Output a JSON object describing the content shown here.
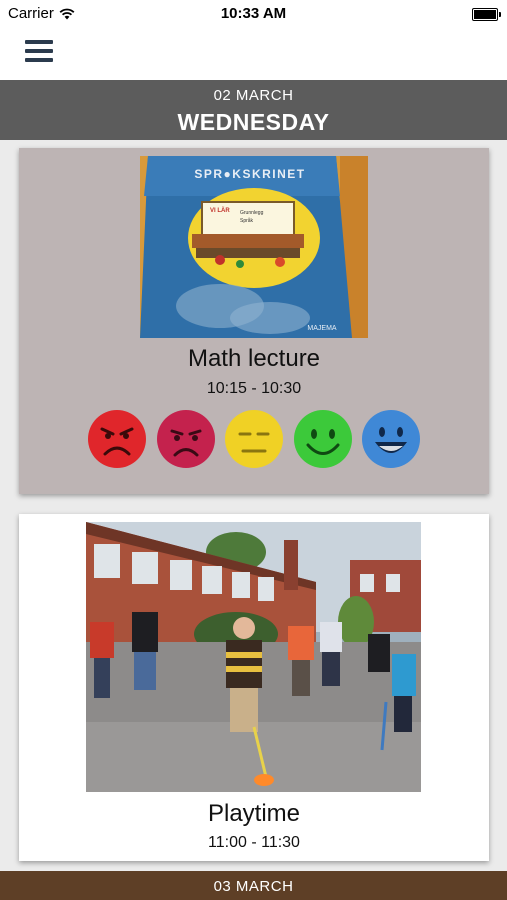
{
  "status_bar": {
    "carrier": "Carrier",
    "time": "10:33 AM",
    "wifi_icon": "wifi-icon",
    "battery_icon": "battery-icon"
  },
  "nav": {
    "menu_icon": "hamburger-menu-icon"
  },
  "day": {
    "date": "02 MARCH",
    "weekday": "WEDNESDAY"
  },
  "events": [
    {
      "title": "Math lecture",
      "time": "10:15 - 10:30",
      "image": {
        "cover_title": "SPR●KSKRINET",
        "label_lines": [
          "VI LÄR",
          "Grunnlegg",
          "Språk"
        ],
        "publisher": "MAJEMA"
      },
      "rating_options": [
        {
          "name": "angry-face-icon",
          "color": "#e0262b"
        },
        {
          "name": "sad-face-icon",
          "color": "#c4224d"
        },
        {
          "name": "neutral-face-icon",
          "color": "#f0d125"
        },
        {
          "name": "smiling-face-icon",
          "color": "#3cc93a"
        },
        {
          "name": "laughing-face-icon",
          "color": "#3f88d6"
        }
      ]
    },
    {
      "title": "Playtime",
      "time": "11:00 - 11:30",
      "image": {}
    }
  ],
  "next_day": {
    "date": "03 MARCH"
  },
  "colors": {
    "day_header": "#5c5c5c",
    "next_day_header": "#5e3f26",
    "card_active": "#bdb4b4",
    "card": "#ffffff"
  }
}
